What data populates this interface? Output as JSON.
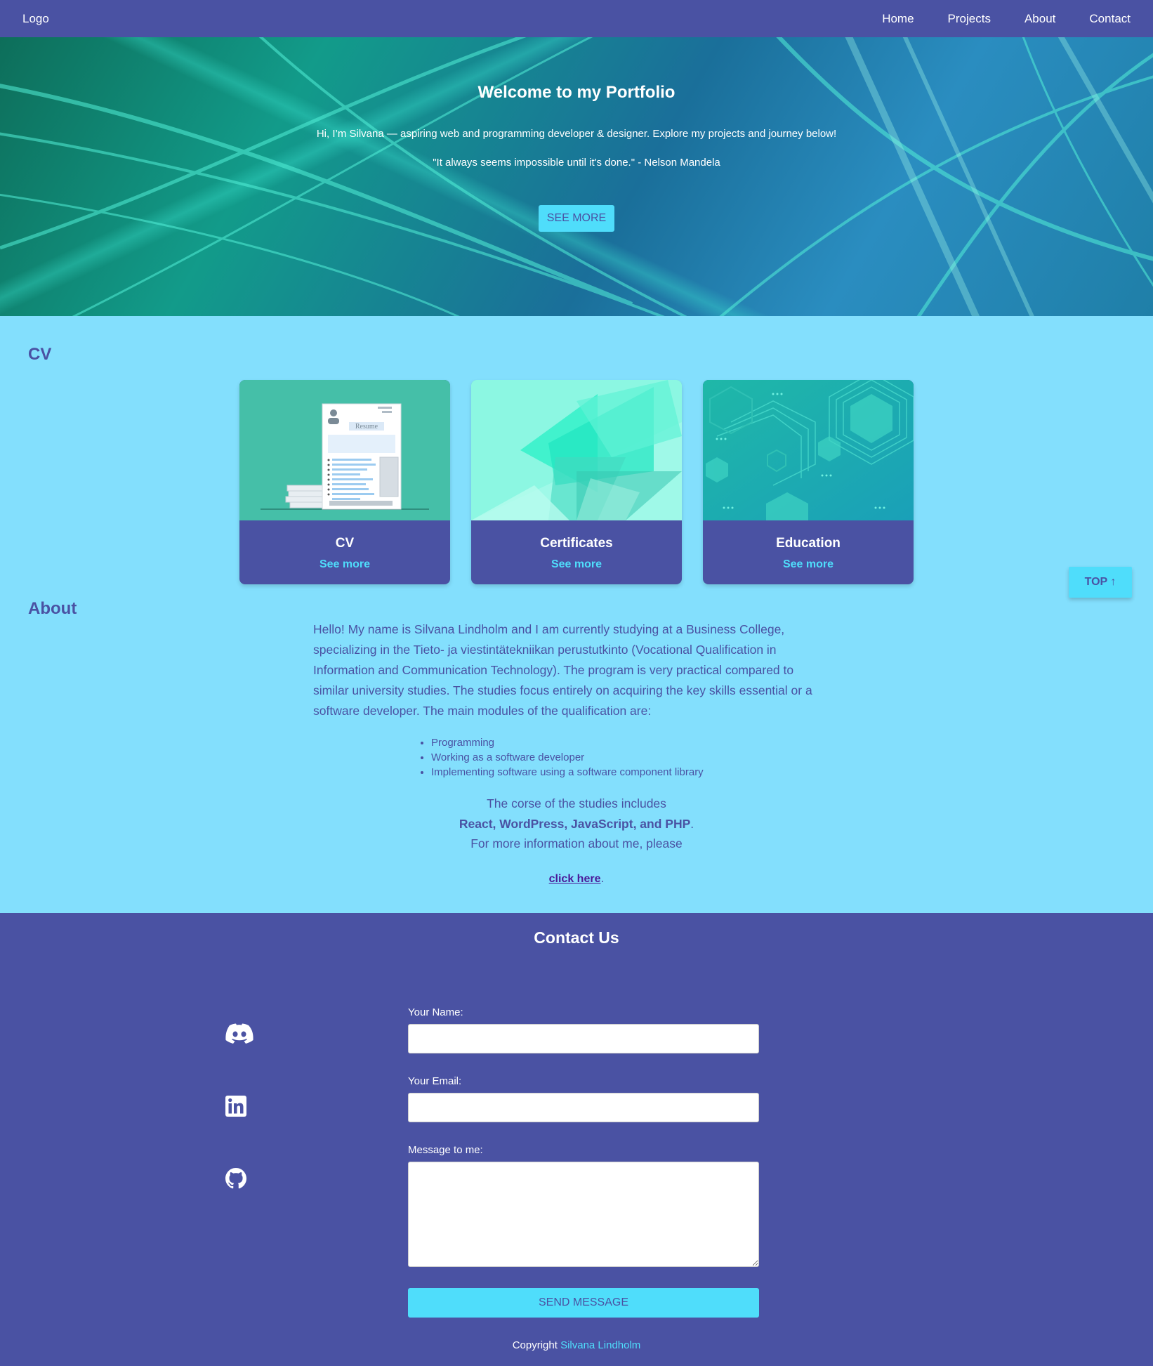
{
  "nav": {
    "logo": "Logo",
    "links": [
      "Home",
      "Projects",
      "About",
      "Contact"
    ]
  },
  "hero": {
    "title": "Welcome to my Portfolio",
    "intro": "Hi, I’m Silvana — aspiring web and programming developer & designer. Explore my projects and journey below!",
    "quote": "\"It always seems impossible until it's done.\" - Nelson Mandela",
    "button": "SEE MORE"
  },
  "cv_section": {
    "heading": "CV",
    "resume_image_label": "Resume",
    "cards": [
      {
        "title": "CV",
        "link": "See more"
      },
      {
        "title": "Certificates",
        "link": "See more"
      },
      {
        "title": "Education",
        "link": "See more"
      }
    ]
  },
  "top_button": "TOP ↑",
  "about": {
    "heading": "About",
    "paragraph": "Hello! My name is Silvana Lindholm and I am currently studying at a Business College, specializing in the Tieto- ja viestintätekniikan perustutkinto (Vocational Qualification in Information and Communication Technology). The program is very practical compared to similar university studies. The studies focus entirely on acquiring the key skills essential or a software developer. The main modules of the qualification are:",
    "modules": [
      "Programming",
      "Working as a software developer",
      "Implementing software using a software component library"
    ],
    "course_line": "The corse of the studies includes",
    "technologies": "React, WordPress, JavaScript, and PHP",
    "technologies_end": ".",
    "more_info": "For more information about me, please",
    "link_text": "click here",
    "link_end": "."
  },
  "contact": {
    "heading": "Contact Us",
    "social_icons": [
      "discord-icon",
      "linkedin-icon",
      "github-icon"
    ],
    "name_label": "Your Name:",
    "email_label": "Your Email:",
    "message_label": "Message to me:",
    "name_value": "",
    "email_value": "",
    "message_value": "",
    "send_button": "SEND MESSAGE"
  },
  "footer": {
    "copyright": "Copyright",
    "name": "Silvana Lindholm"
  },
  "colors": {
    "primary": "#4a52a3",
    "accent": "#4fddfb",
    "page_background": "#83dffd"
  }
}
